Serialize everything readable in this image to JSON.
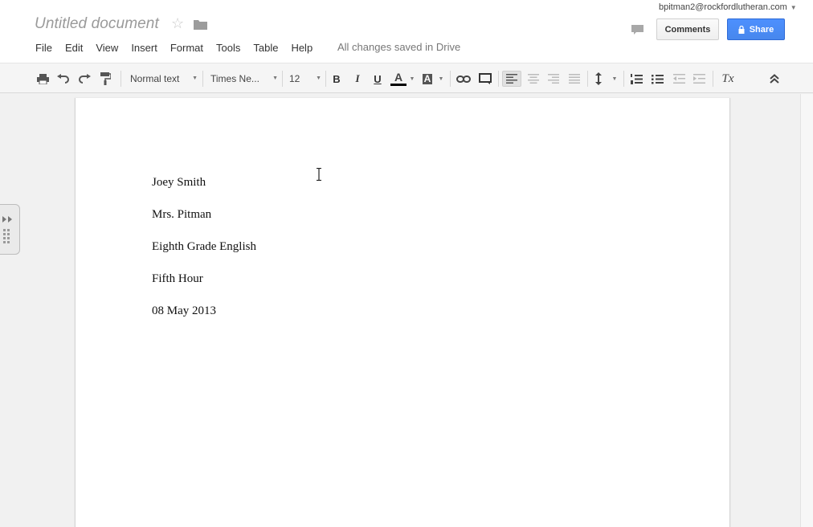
{
  "document": {
    "title": "Untitled document",
    "save_status": "All changes saved in Drive",
    "lines": [
      "Joey Smith",
      "Mrs. Pitman",
      "Eighth Grade English",
      "Fifth Hour",
      "08 May 2013"
    ]
  },
  "menu": [
    "File",
    "Edit",
    "View",
    "Insert",
    "Format",
    "Tools",
    "Table",
    "Help"
  ],
  "account": {
    "email": "bpitman2@rockfordlutheran.com"
  },
  "buttons": {
    "comments": "Comments",
    "share": "Share"
  },
  "toolbar": {
    "style": "Normal text",
    "font": "Times Ne...",
    "size": "12",
    "bold": "B",
    "italic": "I",
    "underline": "U",
    "text_color": "A",
    "highlight": "A",
    "clear_format": "Tx"
  },
  "colors": {
    "share_blue": "#4d90fe",
    "text_color_bar": "#000000"
  },
  "icons": [
    "star-icon",
    "folder-icon",
    "chat-icon",
    "lock-icon",
    "print-icon",
    "undo-icon",
    "redo-icon",
    "paint-format-icon",
    "link-icon",
    "comment-icon",
    "align-left-icon",
    "align-center-icon",
    "align-right-icon",
    "justify-icon",
    "line-spacing-icon",
    "numbered-list-icon",
    "bulleted-list-icon",
    "decrease-indent-icon",
    "increase-indent-icon",
    "collapse-icon",
    "text-cursor-icon"
  ]
}
